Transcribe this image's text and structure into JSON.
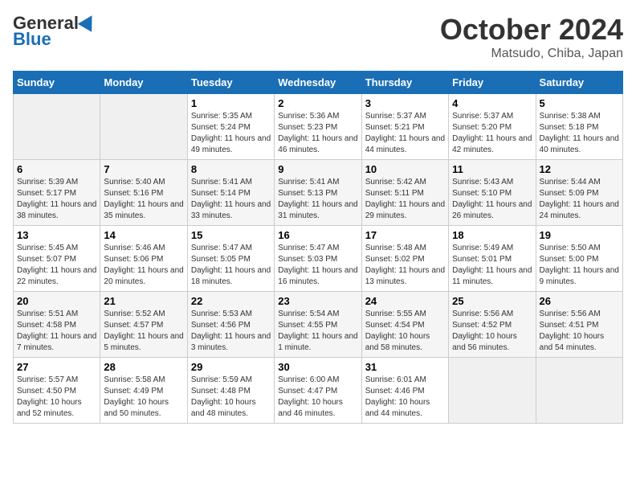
{
  "header": {
    "logo_general": "General",
    "logo_blue": "Blue",
    "title": "October 2024",
    "subtitle": "Matsudo, Chiba, Japan"
  },
  "days_of_week": [
    "Sunday",
    "Monday",
    "Tuesday",
    "Wednesday",
    "Thursday",
    "Friday",
    "Saturday"
  ],
  "weeks": [
    [
      {
        "day": "",
        "info": ""
      },
      {
        "day": "",
        "info": ""
      },
      {
        "day": "1",
        "info": "Sunrise: 5:35 AM\nSunset: 5:24 PM\nDaylight: 11 hours and 49 minutes."
      },
      {
        "day": "2",
        "info": "Sunrise: 5:36 AM\nSunset: 5:23 PM\nDaylight: 11 hours and 46 minutes."
      },
      {
        "day": "3",
        "info": "Sunrise: 5:37 AM\nSunset: 5:21 PM\nDaylight: 11 hours and 44 minutes."
      },
      {
        "day": "4",
        "info": "Sunrise: 5:37 AM\nSunset: 5:20 PM\nDaylight: 11 hours and 42 minutes."
      },
      {
        "day": "5",
        "info": "Sunrise: 5:38 AM\nSunset: 5:18 PM\nDaylight: 11 hours and 40 minutes."
      }
    ],
    [
      {
        "day": "6",
        "info": "Sunrise: 5:39 AM\nSunset: 5:17 PM\nDaylight: 11 hours and 38 minutes."
      },
      {
        "day": "7",
        "info": "Sunrise: 5:40 AM\nSunset: 5:16 PM\nDaylight: 11 hours and 35 minutes."
      },
      {
        "day": "8",
        "info": "Sunrise: 5:41 AM\nSunset: 5:14 PM\nDaylight: 11 hours and 33 minutes."
      },
      {
        "day": "9",
        "info": "Sunrise: 5:41 AM\nSunset: 5:13 PM\nDaylight: 11 hours and 31 minutes."
      },
      {
        "day": "10",
        "info": "Sunrise: 5:42 AM\nSunset: 5:11 PM\nDaylight: 11 hours and 29 minutes."
      },
      {
        "day": "11",
        "info": "Sunrise: 5:43 AM\nSunset: 5:10 PM\nDaylight: 11 hours and 26 minutes."
      },
      {
        "day": "12",
        "info": "Sunrise: 5:44 AM\nSunset: 5:09 PM\nDaylight: 11 hours and 24 minutes."
      }
    ],
    [
      {
        "day": "13",
        "info": "Sunrise: 5:45 AM\nSunset: 5:07 PM\nDaylight: 11 hours and 22 minutes."
      },
      {
        "day": "14",
        "info": "Sunrise: 5:46 AM\nSunset: 5:06 PM\nDaylight: 11 hours and 20 minutes."
      },
      {
        "day": "15",
        "info": "Sunrise: 5:47 AM\nSunset: 5:05 PM\nDaylight: 11 hours and 18 minutes."
      },
      {
        "day": "16",
        "info": "Sunrise: 5:47 AM\nSunset: 5:03 PM\nDaylight: 11 hours and 16 minutes."
      },
      {
        "day": "17",
        "info": "Sunrise: 5:48 AM\nSunset: 5:02 PM\nDaylight: 11 hours and 13 minutes."
      },
      {
        "day": "18",
        "info": "Sunrise: 5:49 AM\nSunset: 5:01 PM\nDaylight: 11 hours and 11 minutes."
      },
      {
        "day": "19",
        "info": "Sunrise: 5:50 AM\nSunset: 5:00 PM\nDaylight: 11 hours and 9 minutes."
      }
    ],
    [
      {
        "day": "20",
        "info": "Sunrise: 5:51 AM\nSunset: 4:58 PM\nDaylight: 11 hours and 7 minutes."
      },
      {
        "day": "21",
        "info": "Sunrise: 5:52 AM\nSunset: 4:57 PM\nDaylight: 11 hours and 5 minutes."
      },
      {
        "day": "22",
        "info": "Sunrise: 5:53 AM\nSunset: 4:56 PM\nDaylight: 11 hours and 3 minutes."
      },
      {
        "day": "23",
        "info": "Sunrise: 5:54 AM\nSunset: 4:55 PM\nDaylight: 11 hours and 1 minute."
      },
      {
        "day": "24",
        "info": "Sunrise: 5:55 AM\nSunset: 4:54 PM\nDaylight: 10 hours and 58 minutes."
      },
      {
        "day": "25",
        "info": "Sunrise: 5:56 AM\nSunset: 4:52 PM\nDaylight: 10 hours and 56 minutes."
      },
      {
        "day": "26",
        "info": "Sunrise: 5:56 AM\nSunset: 4:51 PM\nDaylight: 10 hours and 54 minutes."
      }
    ],
    [
      {
        "day": "27",
        "info": "Sunrise: 5:57 AM\nSunset: 4:50 PM\nDaylight: 10 hours and 52 minutes."
      },
      {
        "day": "28",
        "info": "Sunrise: 5:58 AM\nSunset: 4:49 PM\nDaylight: 10 hours and 50 minutes."
      },
      {
        "day": "29",
        "info": "Sunrise: 5:59 AM\nSunset: 4:48 PM\nDaylight: 10 hours and 48 minutes."
      },
      {
        "day": "30",
        "info": "Sunrise: 6:00 AM\nSunset: 4:47 PM\nDaylight: 10 hours and 46 minutes."
      },
      {
        "day": "31",
        "info": "Sunrise: 6:01 AM\nSunset: 4:46 PM\nDaylight: 10 hours and 44 minutes."
      },
      {
        "day": "",
        "info": ""
      },
      {
        "day": "",
        "info": ""
      }
    ]
  ]
}
